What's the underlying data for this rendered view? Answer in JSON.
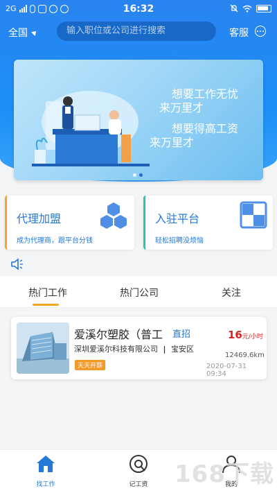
{
  "status_bar": {
    "network": "2G",
    "time": "16:32"
  },
  "header": {
    "city": "全国",
    "search_placeholder": "输入职位或公司进行搜索",
    "service_label": "客服"
  },
  "banner": {
    "line1": "想要工作无忧",
    "line2": "来万里才",
    "line3": "想要得高工资",
    "line4": "来万里才",
    "page_count": 2,
    "active_page": 2
  },
  "cards": [
    {
      "title": "代理加盟",
      "subtitle": "成为代理商，跟平台分钱",
      "icon": "hexagons-icon"
    },
    {
      "title": "入驻平台",
      "subtitle": "轻松招聘没烦恼",
      "icon": "squares-icon"
    }
  ],
  "tabs": [
    {
      "label": "热门工作",
      "active": true
    },
    {
      "label": "热门公司",
      "active": false
    },
    {
      "label": "关注",
      "active": false
    }
  ],
  "jobs": [
    {
      "title": "爱溪尔塑胶（普工",
      "direct_label": "直招",
      "salary_value": "16",
      "salary_unit": "元/小时",
      "company": "深圳爱溪尔科技有限公司",
      "separator": "|",
      "district": "宝安区",
      "distance": "12469.6km",
      "date": "2020-07-31 09:34",
      "tag": "天天开薪"
    }
  ],
  "bottom_nav": [
    {
      "label": "找工作",
      "icon": "home-icon",
      "active": true
    },
    {
      "label": "记工资",
      "icon": "wage-icon",
      "active": false
    },
    {
      "label": "我的",
      "icon": "user-icon",
      "active": false
    }
  ],
  "watermark": "168下载",
  "colors": {
    "primary": "#2478d6",
    "header_blue": "#1b8ff5",
    "accent_orange": "#f5a623",
    "salary_red": "#e02020",
    "teal": "#27c7b5"
  }
}
